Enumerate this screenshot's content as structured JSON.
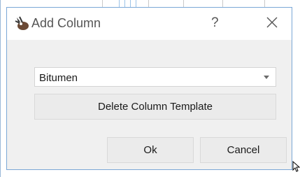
{
  "dialog": {
    "title": "Add Column",
    "app_icon": "app-logo-icon",
    "help_label": "?",
    "close_icon": "close-icon"
  },
  "template_select": {
    "value": "Bitumen",
    "caret_icon": "chevron-down-icon"
  },
  "buttons": {
    "delete_template": "Delete Column Template",
    "ok": "Ok",
    "cancel": "Cancel"
  },
  "colors": {
    "dialog_border": "#7aa7d6",
    "dialog_bg": "#f0f0f0",
    "button_bg": "#ebebeb"
  }
}
